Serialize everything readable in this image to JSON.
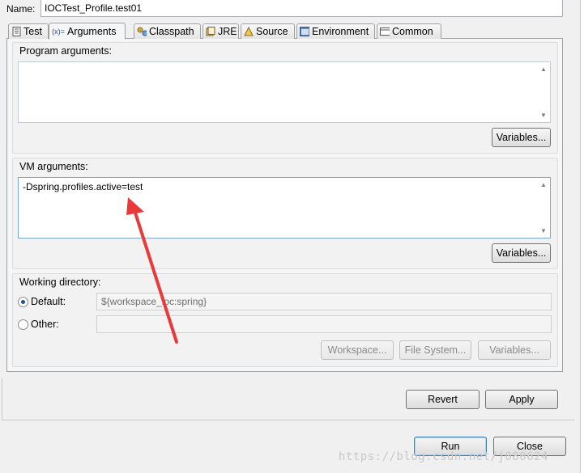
{
  "name": {
    "label": "Name:",
    "value": "IOCTest_Profile.test01"
  },
  "tabs": [
    {
      "label": "Test",
      "icon": "test-doc-icon"
    },
    {
      "label": "Arguments",
      "icon": "arguments-icon"
    },
    {
      "label": "Classpath",
      "icon": "classpath-icon"
    },
    {
      "label": "JRE",
      "icon": "jre-icon"
    },
    {
      "label": "Source",
      "icon": "source-icon"
    },
    {
      "label": "Environment",
      "icon": "environment-icon"
    },
    {
      "label": "Common",
      "icon": "common-icon"
    }
  ],
  "arguments_tab": {
    "program_args": {
      "label": "Program arguments:",
      "value": "",
      "variables_button": "Variables..."
    },
    "vm_args": {
      "label": "VM arguments:",
      "value": "-Dspring.profiles.active=test",
      "variables_button": "Variables..."
    },
    "working_dir": {
      "label": "Working directory:",
      "default_label": "Default:",
      "default_value": "${workspace_loc:spring}",
      "other_label": "Other:",
      "other_value": "",
      "workspace_button": "Workspace...",
      "filesystem_button": "File System...",
      "variables_button": "Variables..."
    }
  },
  "buttons": {
    "revert": "Revert",
    "apply": "Apply",
    "run": "Run",
    "close": "Close"
  },
  "watermark": "https://blog.csdn.net/j080624",
  "colors": {
    "arrow": "#e83a3a",
    "default_button_border": "#3c7fb1"
  }
}
